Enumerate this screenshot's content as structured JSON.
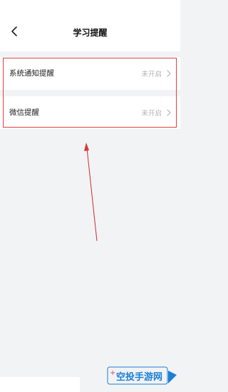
{
  "header": {
    "title": "学习提醒",
    "back_icon": "back-chevron-icon"
  },
  "settings": [
    {
      "label": "系统通知提醒",
      "status": "未开启",
      "icon": "chevron-right-icon"
    },
    {
      "label": "微信提醒",
      "status": "未开启",
      "icon": "chevron-right-icon"
    }
  ],
  "annotation": {
    "highlight_color": "#e0403f"
  },
  "watermark": {
    "text": "空投手游网",
    "plus_symbol": "+"
  },
  "colors": {
    "background": "#f2f3f5",
    "surface": "#ffffff",
    "muted_text": "#b4b4b4",
    "watermark_blue": "#1a7fd6",
    "watermark_pink": "#e0407a"
  }
}
